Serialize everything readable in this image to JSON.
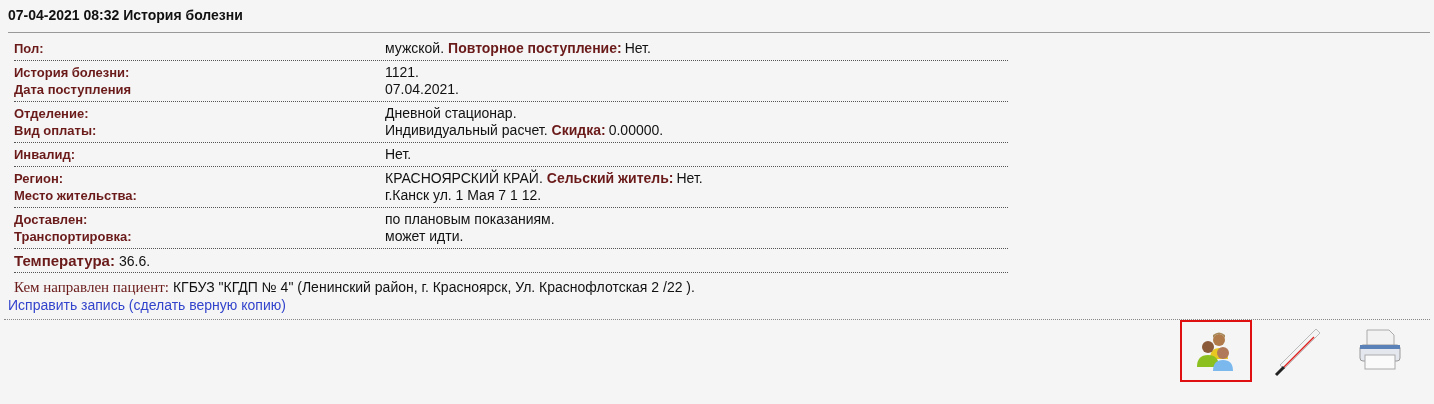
{
  "title": "07-04-2021 08:32 История болезни",
  "groups": [
    {
      "rows": [
        {
          "label": "Пол:",
          "value": "мужской.",
          "extra_label": "Повторное поступление:",
          "extra_value": "Нет."
        }
      ]
    },
    {
      "rows": [
        {
          "label": "История болезни:",
          "value": "1121."
        },
        {
          "label": "Дата поступления",
          "value": "07.04.2021."
        }
      ]
    },
    {
      "rows": [
        {
          "label": "Отделение:",
          "value": "Дневной стационар."
        },
        {
          "label": "Вид оплаты:",
          "value": "Индивидуальный расчет.",
          "extra_label": "Скидка:",
          "extra_value": "0.00000."
        }
      ]
    },
    {
      "rows": [
        {
          "label": "Инвалид:",
          "value": "Нет."
        }
      ]
    },
    {
      "rows": [
        {
          "label": "Регион:",
          "value": "КРАСНОЯРСКИЙ КРАЙ.",
          "extra_label": "Сельский житель:",
          "extra_value": "Нет."
        },
        {
          "label": "Место жительства:",
          "value": "г.Канск ул. 1 Мая 7 1 12."
        }
      ]
    },
    {
      "rows": [
        {
          "label": "Доставлен:",
          "value": "по плановым показаниям."
        },
        {
          "label": "Транспортировка:",
          "value": "может идти."
        }
      ]
    }
  ],
  "temperature": {
    "label": "Температура:",
    "value": "36.6."
  },
  "referral": {
    "label": "Кем направлен пациент:",
    "value": "КГБУЗ \"КГДП № 4\" (Ленинский район, г. Красноярск, Ул. Краснофлотская 2 /22 )."
  },
  "edit_link": "Исправить запись (сделать верную копию)",
  "toolbar": [
    {
      "kind": "people",
      "selected": true
    },
    {
      "kind": "thermometer",
      "selected": false
    },
    {
      "kind": "printer",
      "selected": false
    }
  ]
}
